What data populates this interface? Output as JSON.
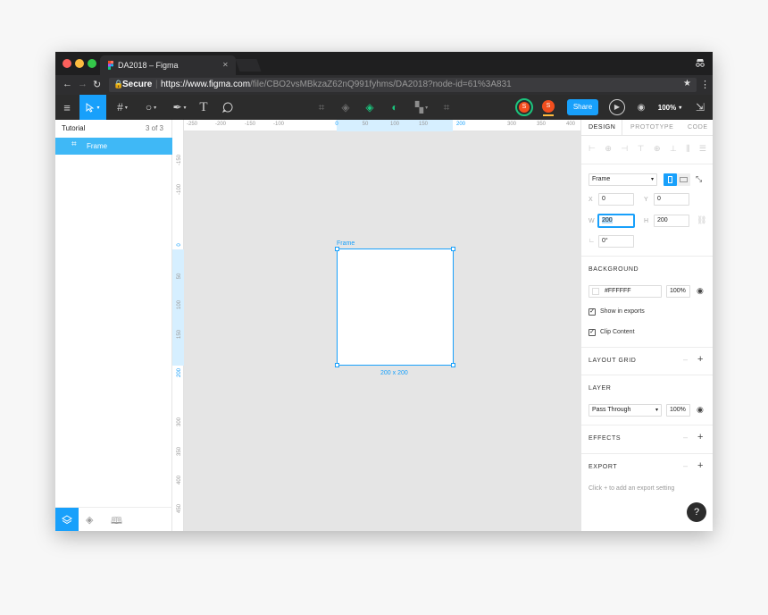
{
  "browser": {
    "tab_title": "DA2018 – Figma",
    "tab_close": "✕",
    "secure_label": "Secure",
    "url_host": "https://www.figma.com",
    "url_path": "/file/CBO2vsMBkzaZ62nQ991fyhms/DA2018?node-id=61%3A831"
  },
  "toolbar": {
    "zoom": "100%",
    "share_label": "Share",
    "avatar1": "S",
    "avatar2": "S"
  },
  "layers_panel": {
    "page_name": "Tutorial",
    "page_count": "3 of 3",
    "selected_layer": "Frame"
  },
  "rulers": {
    "horizontal": [
      "-250",
      "-200",
      "-150",
      "-100",
      "0",
      "50",
      "100",
      "150",
      "200",
      "300",
      "350",
      "400"
    ],
    "vertical": [
      "-150",
      "-100",
      "0",
      "50",
      "100",
      "150",
      "200",
      "300",
      "350",
      "400",
      "450"
    ]
  },
  "canvas": {
    "frame_label": "Frame",
    "size_label": "200 x 200",
    "accent_color": "#18a0fb"
  },
  "inspector": {
    "tabs": [
      "DESIGN",
      "PROTOTYPE",
      "CODE"
    ],
    "frame_preset": "Frame",
    "x_label": "X",
    "x_value": "0",
    "y_label": "Y",
    "y_value": "0",
    "w_label": "W",
    "w_value": "200",
    "h_label": "H",
    "h_value": "200",
    "rotation_value": "0°",
    "background_title": "BACKGROUND",
    "bg_hex": "#FFFFFF",
    "bg_opacity": "100%",
    "show_in_exports": "Show in exports",
    "clip_content": "Clip Content",
    "layout_grid_title": "LAYOUT GRID",
    "layer_title": "LAYER",
    "blend_mode": "Pass Through",
    "layer_opacity": "100%",
    "effects_title": "EFFECTS",
    "export_title": "EXPORT",
    "export_hint": "Click + to add an export setting",
    "help": "?"
  }
}
